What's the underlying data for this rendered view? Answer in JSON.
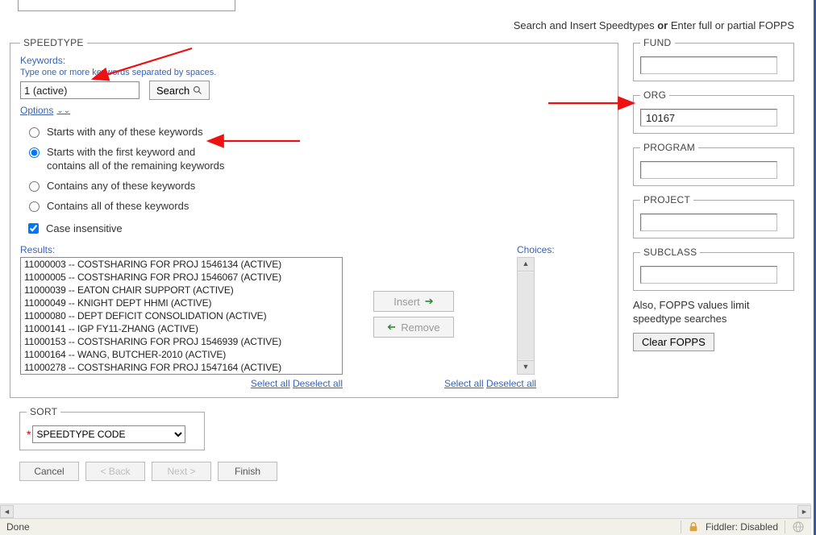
{
  "instruction": {
    "left": "Search and Insert Speedtypes",
    "or": "or",
    "right": "Enter full or partial FOPPS"
  },
  "speedtype": {
    "legend": "SPEEDTYPE",
    "keywords_label": "Keywords:",
    "keywords_hint": "Type one or more keywords separated by spaces.",
    "keywords_value": "1 (active)",
    "search_label": "Search",
    "options_label": "Options",
    "radios": {
      "r1": "Starts with any of these keywords",
      "r2": "Starts with the first keyword and contains all of the remaining keywords",
      "r3": "Contains any of these keywords",
      "r4": "Contains all of these keywords"
    },
    "case_label": "Case insensitive",
    "results_label": "Results:",
    "choices_label": "Choices:",
    "results": [
      "11000003 -- COSTSHARING FOR PROJ 1546134 (ACTIVE)",
      "11000005 -- COSTSHARING FOR PROJ 1546067 (ACTIVE)",
      "11000039 -- EATON CHAIR SUPPORT (ACTIVE)",
      "11000049 -- KNIGHT DEPT HHMI (ACTIVE)",
      "11000080 -- DEPT DEFICIT CONSOLIDATION (ACTIVE)",
      "11000141 -- IGP FY11-ZHANG (ACTIVE)",
      "11000153 -- COSTSHARING FOR PROJ 1546939 (ACTIVE)",
      "11000164 -- WANG, BUTCHER-2010 (ACTIVE)",
      "11000278 -- COSTSHARING FOR PROJ 1547164 (ACTIVE)"
    ],
    "insert_label": "Insert",
    "remove_label": "Remove",
    "select_all": "Select all",
    "deselect_all": "Deselect all"
  },
  "fopps": {
    "fund_legend": "FUND",
    "fund_value": "",
    "org_legend": "ORG",
    "org_value": "10167",
    "program_legend": "PROGRAM",
    "program_value": "",
    "project_legend": "PROJECT",
    "project_value": "",
    "subclass_legend": "SUBCLASS",
    "subclass_value": "",
    "also_text": "Also, FOPPS values limit speedtype searches",
    "clear_label": "Clear FOPPS"
  },
  "sort": {
    "legend": "SORT",
    "value": "SPEEDTYPE CODE"
  },
  "nav": {
    "cancel": "Cancel",
    "back": "< Back",
    "next": "Next >",
    "finish": "Finish"
  },
  "status": {
    "done": "Done",
    "fiddler": "Fiddler: Disabled"
  }
}
